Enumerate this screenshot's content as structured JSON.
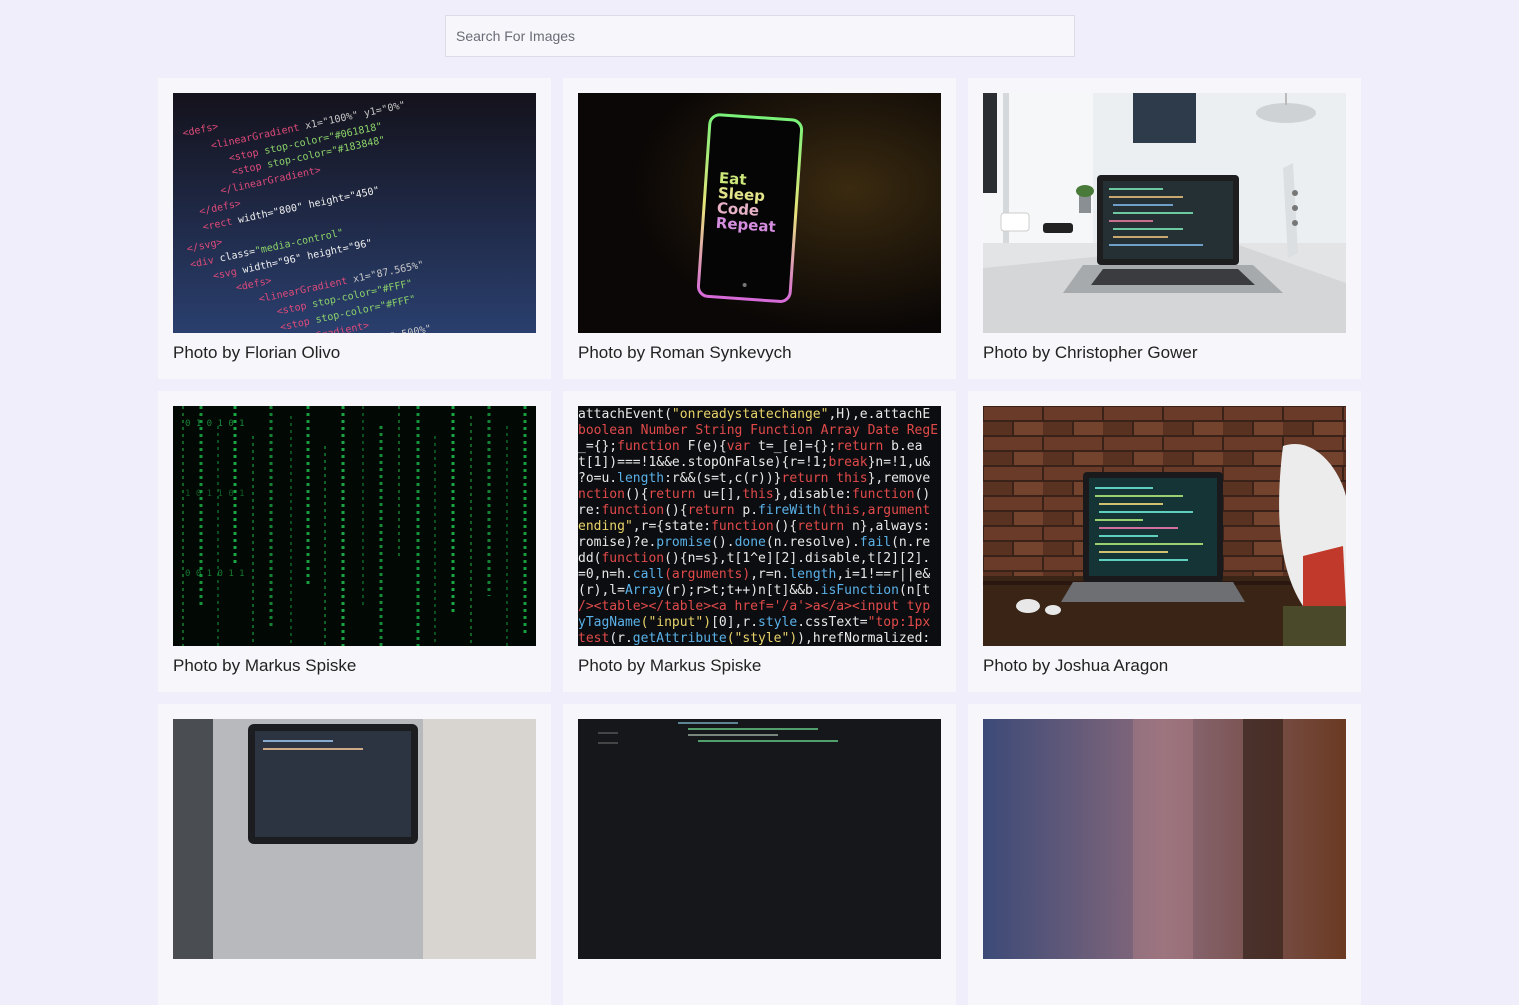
{
  "search": {
    "placeholder": "Search For Images",
    "value": ""
  },
  "photos": [
    {
      "caption": "Photo by Florian Olivo",
      "icon": "code-screen-image"
    },
    {
      "caption": "Photo by Roman Synkevych",
      "icon": "phone-image",
      "phone_text": [
        "Eat",
        "Sleep",
        "Code",
        "Repeat"
      ]
    },
    {
      "caption": "Photo by Christopher Gower",
      "icon": "laptop-desk-image"
    },
    {
      "caption": "Photo by Markus Spiske",
      "icon": "matrix-code-image"
    },
    {
      "caption": "Photo by Markus Spiske",
      "icon": "colorful-code-image"
    },
    {
      "caption": "Photo by Joshua Aragon",
      "icon": "laptop-brick-wall-image"
    },
    {
      "caption": "",
      "icon": "laptop-image"
    },
    {
      "caption": "",
      "icon": "dark-code-image"
    },
    {
      "caption": "",
      "icon": "blurred-room-image"
    }
  ],
  "colors": {
    "background": "#f1eefb",
    "card": "#f7f7fb",
    "text": "#222222"
  }
}
